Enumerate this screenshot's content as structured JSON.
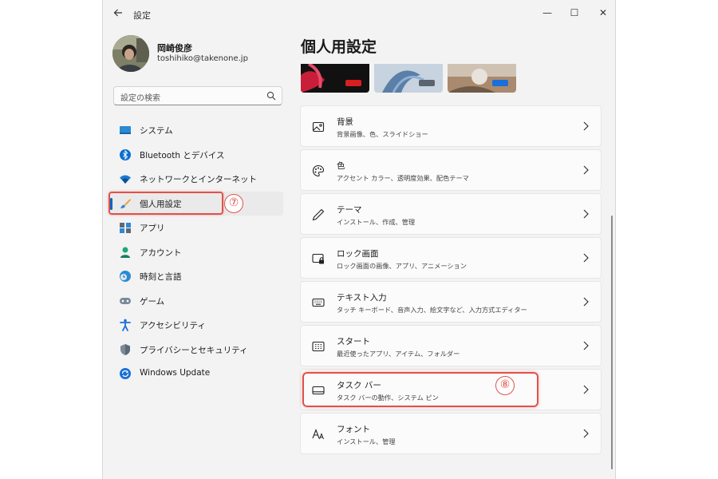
{
  "window": {
    "title": "設定",
    "controls": {
      "minimize": "—",
      "maximize": "☐",
      "close": "✕"
    }
  },
  "profile": {
    "name": "岡崎俊彦",
    "email": "toshihiko@takenone.jp"
  },
  "search": {
    "placeholder": "設定の検索"
  },
  "sidebar": {
    "items": [
      {
        "label": "システム",
        "icon": "system-icon"
      },
      {
        "label": "Bluetooth とデバイス",
        "icon": "bluetooth-icon"
      },
      {
        "label": "ネットワークとインターネット",
        "icon": "wifi-icon"
      },
      {
        "label": "個人用設定",
        "icon": "brush-icon",
        "active": true
      },
      {
        "label": "アプリ",
        "icon": "apps-icon"
      },
      {
        "label": "アカウント",
        "icon": "account-icon"
      },
      {
        "label": "時刻と言語",
        "icon": "clock-globe-icon"
      },
      {
        "label": "ゲーム",
        "icon": "gamepad-icon"
      },
      {
        "label": "アクセシビリティ",
        "icon": "accessibility-icon"
      },
      {
        "label": "プライバシーとセキュリティ",
        "icon": "shield-icon"
      },
      {
        "label": "Windows Update",
        "icon": "update-icon"
      }
    ]
  },
  "main": {
    "title": "個人用設定",
    "themes": [
      {
        "swatch": "#d81e1e"
      },
      {
        "swatch": "#5a6470"
      },
      {
        "swatch": "#1a6fd8"
      }
    ],
    "settings": [
      {
        "title": "背景",
        "sub": "背景画像、色、スライドショー",
        "icon": "picture-icon"
      },
      {
        "title": "色",
        "sub": "アクセント カラー、透明度効果、配色テーマ",
        "icon": "palette-icon"
      },
      {
        "title": "テーマ",
        "sub": "インストール、作成、管理",
        "icon": "pen-icon"
      },
      {
        "title": "ロック画面",
        "sub": "ロック画面の画像、アプリ、アニメーション",
        "icon": "lock-screen-icon"
      },
      {
        "title": "テキスト入力",
        "sub": "タッチ キーボード、音声入力、絵文字など、入力方式エディター",
        "icon": "keyboard-icon"
      },
      {
        "title": "スタート",
        "sub": "最近使ったアプリ、アイテム、フォルダー",
        "icon": "start-icon"
      },
      {
        "title": "タスク バー",
        "sub": "タスク バーの動作、システム ピン",
        "icon": "taskbar-icon"
      },
      {
        "title": "フォント",
        "sub": "インストール、管理",
        "icon": "font-icon"
      }
    ]
  },
  "annotations": {
    "badge7": "⑦",
    "badge8": "⑧"
  },
  "colors": {
    "accent": "#0067c0",
    "highlight": "#e0524a"
  }
}
